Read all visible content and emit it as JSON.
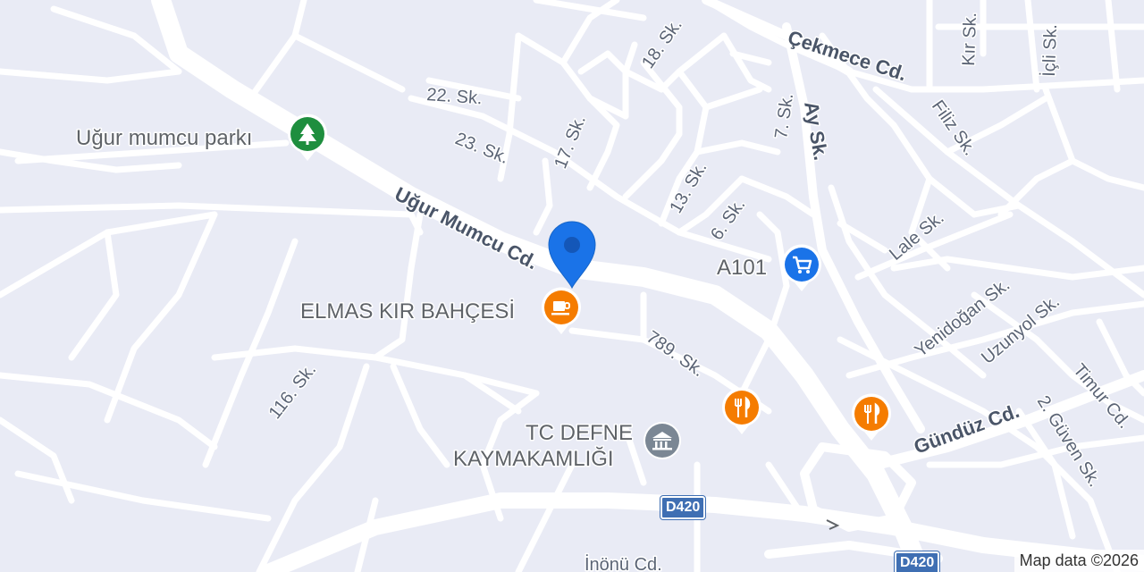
{
  "map": {
    "streets": {
      "ugur_mumcu_cd": "Uğur Mumcu Cd.",
      "cekmece_cd": "Çekmece Cd.",
      "s22": "22. Sk.",
      "s23": "23. Sk.",
      "s17": "17. Sk.",
      "s18": "18. Sk.",
      "s13": "13. Sk.",
      "s6": "6. Sk.",
      "s7": "7. Sk.",
      "ay": "Ay Sk.",
      "kir": "Kır Sk.",
      "icli": "İçli Sk.",
      "filiz": "Filiz Sk.",
      "lale": "Lale Sk.",
      "yenidogan": "Yenidoğan Sk.",
      "uzunyol": "Uzunyol Sk.",
      "timur": "Timur Cd.",
      "guven": "2. Güven Sk.",
      "gunduz": "Gündüz Cd.",
      "s789": "789. Sk.",
      "s116": "116. Sk.",
      "inonu": "İnönü Cd."
    },
    "pois": {
      "park": {
        "label": "Uğur mumcu parkı",
        "icon": "park-icon",
        "color": "#1e8e3e"
      },
      "cafe": {
        "label": "ELMAS KIR BAHÇESİ",
        "icon": "cafe-icon",
        "color": "#f57c00"
      },
      "market": {
        "label": "A101",
        "icon": "shopping-cart-icon",
        "color": "#1a73e8"
      },
      "gov_line1": "TC DEFNE",
      "gov_line2": "KAYMAKAMLIĞI",
      "gov_icon": "government-icon",
      "restaurant1_icon": "restaurant-icon",
      "restaurant2_icon": "restaurant-icon"
    },
    "shields": {
      "d420_a": "D420",
      "d420_b": "D420"
    },
    "marker": {
      "icon": "location-pin-icon",
      "color": "#1a73e8"
    },
    "attribution": "Map data ©2026"
  }
}
